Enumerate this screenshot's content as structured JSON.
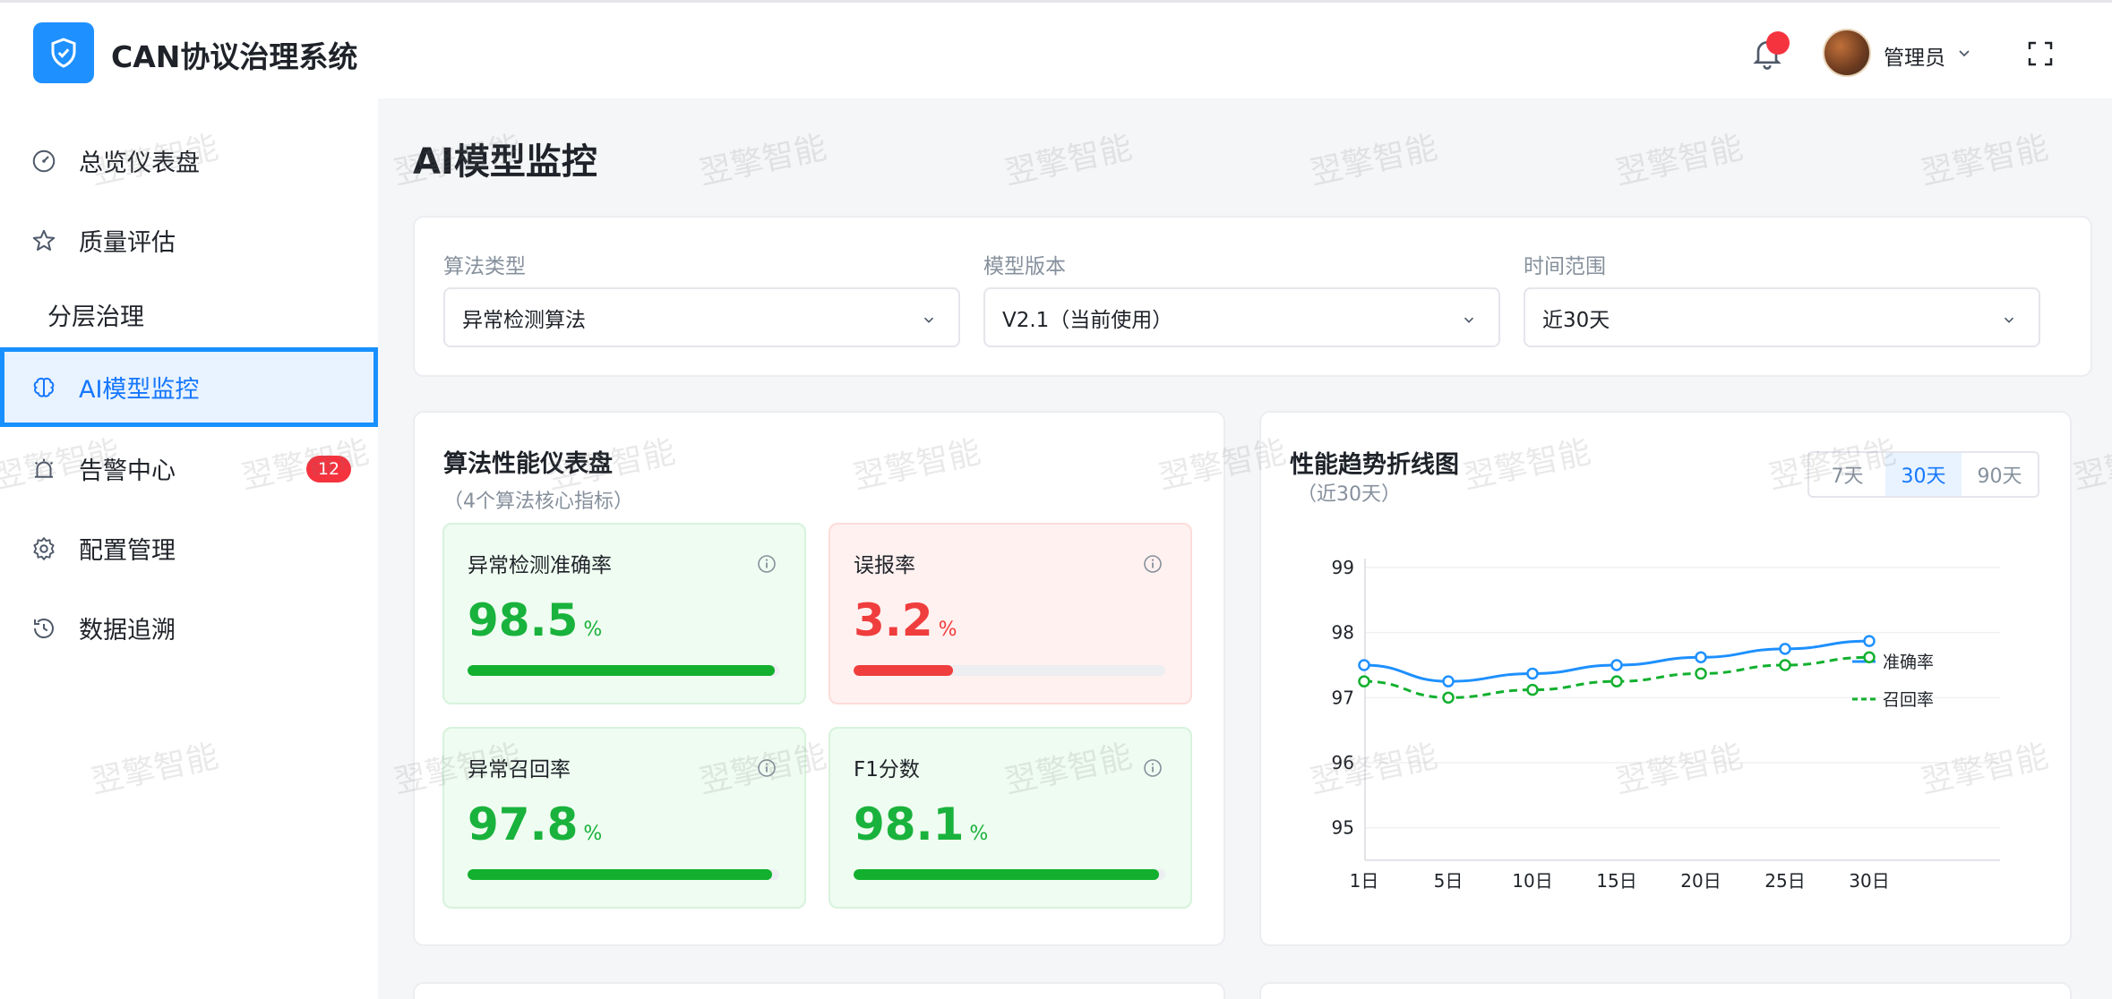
{
  "header": {
    "app_title": "CAN协议治理系统",
    "logo_icon": "shield-check-icon",
    "user_name": "管理员",
    "accent": "#1e90ff"
  },
  "sidebar": {
    "items": [
      {
        "label": "总览仪表盘",
        "icon": "dashboard-icon"
      },
      {
        "label": "质量评估",
        "icon": "star-icon"
      },
      {
        "label": "分层治理"
      },
      {
        "label": "AI模型监控",
        "icon": "brain-icon",
        "active": true
      },
      {
        "label": "告警中心",
        "icon": "alarm-icon",
        "badge": "12"
      },
      {
        "label": "配置管理",
        "icon": "gear-icon"
      },
      {
        "label": "数据追溯",
        "icon": "history-icon"
      }
    ]
  },
  "page": {
    "title": "AI模型监控"
  },
  "filters": {
    "algorithm": {
      "label": "算法类型",
      "value": "异常检测算法"
    },
    "version": {
      "label": "模型版本",
      "value": "V2.1（当前使用）"
    },
    "time": {
      "label": "时间范围",
      "value": "近30天"
    }
  },
  "perf": {
    "title": "算法性能仪表盘",
    "subtitle": "（4个算法核心指标）",
    "metrics": [
      {
        "label": "异常检测准确率",
        "value": "98.5",
        "unit": "%",
        "progress": 0.985,
        "status": "good"
      },
      {
        "label": "误报率",
        "value": "3.2",
        "unit": "%",
        "progress": 0.32,
        "status": "bad"
      },
      {
        "label": "异常召回率",
        "value": "97.8",
        "unit": "%",
        "progress": 0.978,
        "status": "good"
      },
      {
        "label": "F1分数",
        "value": "98.1",
        "unit": "%",
        "progress": 0.981,
        "status": "good"
      }
    ]
  },
  "trend": {
    "title": "性能趋势折线图",
    "subtitle": "（近30天）",
    "ranges": [
      "7天",
      "30天",
      "90天"
    ],
    "active_range": "30天"
  },
  "chart_data": {
    "type": "line",
    "x": [
      "1日",
      "5日",
      "10日",
      "15日",
      "20日",
      "25日",
      "30日"
    ],
    "yticks": [
      95,
      96,
      97,
      98,
      99
    ],
    "ylim": [
      94.5,
      99
    ],
    "series": [
      {
        "name": "准确率",
        "values": [
          97.5,
          97.25,
          97.37,
          97.5,
          97.62,
          97.75,
          97.87
        ],
        "color": "#1e90ff",
        "style": "solid"
      },
      {
        "name": "召回率",
        "values": [
          97.25,
          97.0,
          97.12,
          97.25,
          97.37,
          97.5,
          97.62
        ],
        "color": "#12b02e",
        "style": "dashed"
      }
    ],
    "legend": "right",
    "grid": true
  },
  "watermark": "翌擎智能"
}
